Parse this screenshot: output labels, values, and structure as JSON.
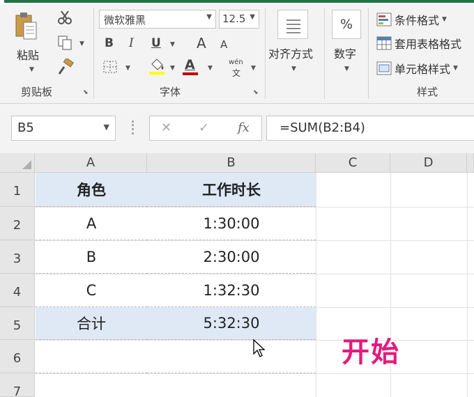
{
  "ribbon": {
    "clipboard": {
      "paste_label": "粘贴",
      "group_label": "剪贴板"
    },
    "font": {
      "font_name": "微软雅黑",
      "font_size": "12.5",
      "bold": "B",
      "italic": "I",
      "underline": "U",
      "grow": "A",
      "shrink": "A",
      "font_color": "A",
      "phonetic_top": "wén",
      "phonetic_bottom": "文",
      "group_label": "字体"
    },
    "alignment": {
      "label": "对齐方式"
    },
    "number": {
      "symbol": "%",
      "label": "数字"
    },
    "styles": {
      "conditional": "条件格式",
      "table": "套用表格格式",
      "cell": "单元格样式",
      "group_label": "样式"
    }
  },
  "formula_bar": {
    "name_box": "B5",
    "cancel": "✕",
    "enter": "✓",
    "fx": "fx",
    "formula": "=SUM(B2:B4)"
  },
  "sheet": {
    "columns": [
      "A",
      "B",
      "C",
      "D"
    ],
    "rows": [
      "1",
      "2",
      "3",
      "4",
      "5",
      "6",
      "7"
    ],
    "header": [
      "角色",
      "工作时长"
    ],
    "data": [
      [
        "A",
        "1:30:00"
      ],
      [
        "B",
        "2:30:00"
      ],
      [
        "C",
        "1:32:30"
      ]
    ],
    "total": [
      "合计",
      "5:32:30"
    ]
  },
  "overlay": {
    "start_text": "开始"
  },
  "colors": {
    "accent_green": "#217346",
    "highlight": "#dfe9f5",
    "start_text": "#e5197d"
  },
  "icons": [
    "paste-icon",
    "cut-icon",
    "copy-icon",
    "format-painter-icon",
    "border-icon",
    "fill-color-icon",
    "align-icon",
    "conditional-format-icon",
    "table-format-icon",
    "cell-style-icon",
    "mouse-pointer-icon"
  ]
}
